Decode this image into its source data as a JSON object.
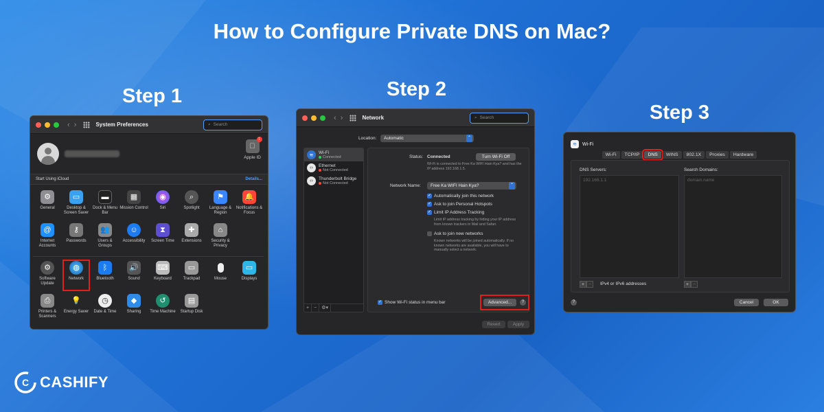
{
  "page": {
    "title": "How to Configure Private DNS on Mac?",
    "brand": "CASHIFY"
  },
  "steps": [
    "Step 1",
    "Step 2",
    "Step 3"
  ],
  "win1": {
    "title": "System Preferences",
    "search_placeholder": "Search",
    "apple_id": "Apple ID",
    "apple_badge": "1",
    "icloud_label": "Start Using iCloud",
    "details": "Details...",
    "prefs_row1": [
      "General",
      "Desktop & Screen Saver",
      "Dock & Menu Bar",
      "Mission Control",
      "Siri",
      "Spotlight",
      "Language & Region",
      "Notifications & Focus"
    ],
    "prefs_row2": [
      "Internet Accounts",
      "Passwords",
      "Users & Groups",
      "Accessibility",
      "Screen Time",
      "Extensions",
      "Security & Privacy"
    ],
    "prefs_row3": [
      "Software Update",
      "Network",
      "Bluetooth",
      "Sound",
      "Keyboard",
      "Trackpad",
      "Mouse",
      "Displays"
    ],
    "prefs_row4": [
      "Printers & Scanners",
      "Energy Saver",
      "Date & Time",
      "Sharing",
      "Time Machine",
      "Startup Disk"
    ]
  },
  "win2": {
    "title": "Network",
    "search_placeholder": "Search",
    "location_label": "Location:",
    "location_value": "Automatic",
    "services": [
      {
        "name": "Wi-Fi",
        "status": "Connected"
      },
      {
        "name": "Ethernet",
        "status": "Not Connected"
      },
      {
        "name": "Thunderbolt Bridge",
        "status": "Not Connected"
      }
    ],
    "status_label": "Status:",
    "status_value": "Connected",
    "turn_off": "Turn Wi-Fi Off",
    "status_desc": "Wi-Fi is connected to Free Ka WIFI Hain Kya? and has the IP address 192.168.1.5.",
    "network_name_label": "Network Name:",
    "network_name_value": "Free Ka WIFI Hain Kya?",
    "auto_join": "Automatically join this network",
    "ask_hotspots": "Ask to join Personal Hotspots",
    "limit_ip": "Limit IP Address Tracking",
    "limit_ip_desc": "Limit IP address tracking by hiding your IP address from known trackers in Mail and Safari.",
    "ask_new": "Ask to join new networks",
    "ask_new_desc": "Known networks will be joined automatically. If no known networks are available, you will have to manually select a network.",
    "show_wifi": "Show Wi-Fi status in menu bar",
    "advanced": "Advanced...",
    "help": "?",
    "revert": "Revert",
    "apply": "Apply",
    "sidebar_buttons": [
      "+",
      "−",
      "⚙▾"
    ]
  },
  "win3": {
    "title": "Wi-Fi",
    "tabs": [
      "Wi-Fi",
      "TCP/IP",
      "DNS",
      "WINS",
      "802.1X",
      "Proxies",
      "Hardware"
    ],
    "dns_label": "DNS Servers:",
    "dns_entry": "192.168.1.1",
    "domains_label": "Search Domains:",
    "domains_placeholder": "domain.name",
    "ipv_label": "IPv4 or IPv6 addresses",
    "plus": "+",
    "minus": "−",
    "help": "?",
    "cancel": "Cancel",
    "ok": "OK"
  },
  "colors": {
    "highlight": "#e41d1d",
    "accent": "#2f74d0",
    "background": "#2379dc"
  }
}
